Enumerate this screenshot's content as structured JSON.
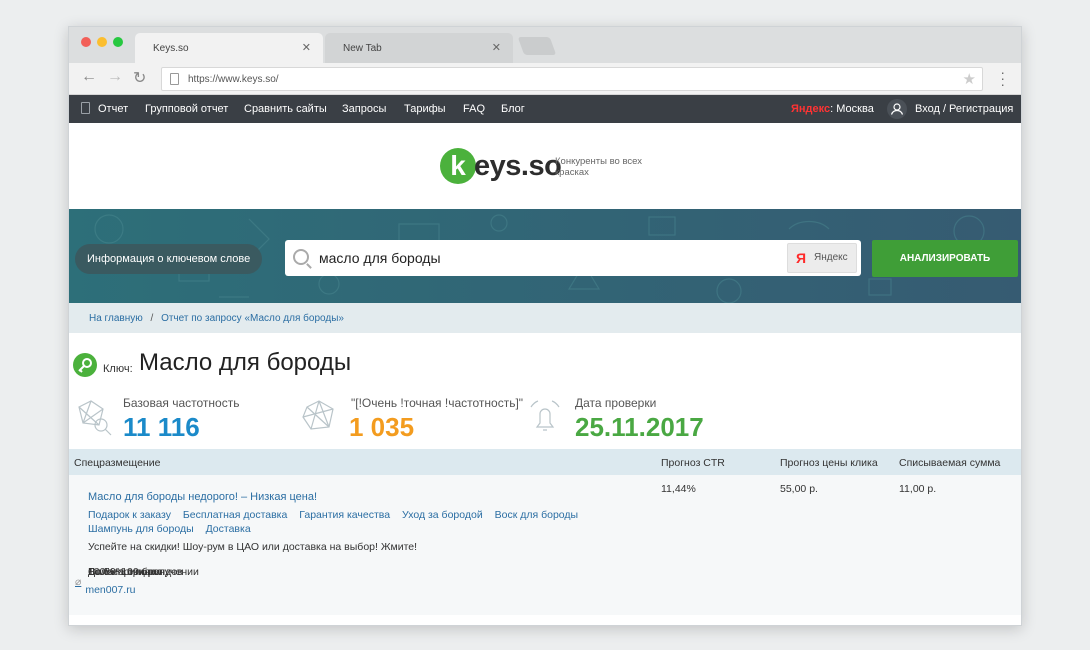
{
  "browser": {
    "tabs": [
      {
        "title": "Keys.so"
      },
      {
        "title": "New Tab"
      }
    ],
    "close_glyph": "✕",
    "url": "https://www.keys.so/",
    "traffic_lights": [
      "#f25f58",
      "#fbbe2f",
      "#27c840"
    ]
  },
  "sitenav": {
    "items": [
      "Отчет",
      "Групповой отчет",
      "Сравнить сайты",
      "Запросы",
      "Тарифы",
      "FAQ",
      "Блог"
    ],
    "yandex_prefix": "Яндекс",
    "region": ": Москва",
    "login": "Вход / Регистрация"
  },
  "logo": {
    "k": "k",
    "rest": "eys.so",
    "tagline": "Конкуренты во всех красках"
  },
  "search": {
    "mode_pill": "Информация о ключевом слове",
    "query": "масло для бороды",
    "engine_letter": "Я",
    "engine": "Яндекс",
    "analyze": "АНАЛИЗИРОВАТЬ"
  },
  "breadcrumb": {
    "home": "На главную",
    "sep": "/",
    "current": "Отчет по запросу «Масло для бороды»"
  },
  "keyword": {
    "label": "Ключ:",
    "title": "Масло для бороды"
  },
  "stats": [
    {
      "label": "Базовая частотность",
      "value": "11 116",
      "color": "#1b8ac9"
    },
    {
      "label": "\"[!Очень !точная !частотность]\"",
      "value": "1 035",
      "color": "#f39c1f"
    },
    {
      "label": "Дата проверки",
      "value": "25.11.2017",
      "color": "#4aa843"
    }
  ],
  "table": {
    "headers": [
      "Спецразмещение",
      "Прогноз CTR",
      "Прогноз цены клика",
      "Списываемая сумма"
    ],
    "ad": {
      "title": "Масло для бороды недорого! – Низкая цена!",
      "sitelinks": [
        "Подарок к заказу",
        "Бесплатная доставка",
        "Гарантия качества",
        "Уход за бородой",
        "Воск для бороды",
        "Шампунь для бороды",
        "Доставка"
      ],
      "text": "Успейте на скидки! Шоу-рум в ЦАО или доставка на выбор! Жмите!",
      "features": [
        "100% оригинал",
        "Более 100 брендов",
        "До 50% скидки",
        "Оплата при получении"
      ],
      "url": "men007.ru",
      "ctr": "11,44%",
      "click_price": "55,00 р.",
      "charge": "11,00 р."
    }
  }
}
